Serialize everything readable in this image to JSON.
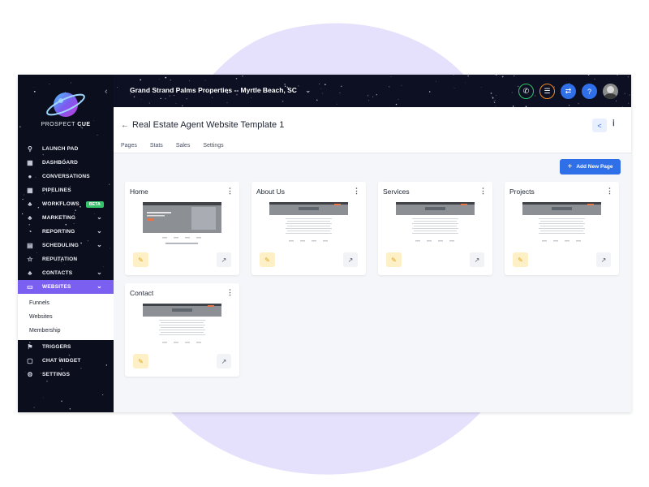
{
  "sidebar": {
    "brand_main": "PROSPECT",
    "brand_accent": "CUE",
    "collapse_icon": "‹",
    "nav": [
      {
        "label": "LAUNCH PAD",
        "icon": "rocket-icon",
        "glyph": "⚲"
      },
      {
        "label": "DASHBOARD",
        "icon": "dashboard-icon",
        "glyph": "▦"
      },
      {
        "label": "CONVERSATIONS",
        "icon": "conversations-icon",
        "glyph": "●"
      },
      {
        "label": "PIPELINES",
        "icon": "pipelines-icon",
        "glyph": "▦"
      },
      {
        "label": "WORKFLOWS",
        "icon": "workflows-icon",
        "glyph": "♣",
        "badge": "BETA"
      },
      {
        "label": "MARKETING",
        "icon": "marketing-icon",
        "glyph": "♣",
        "chevron": "⌄"
      },
      {
        "label": "REPORTING",
        "icon": "reporting-icon",
        "glyph": "◔",
        "chevron": "⌄"
      },
      {
        "label": "SCHEDULING",
        "icon": "calendar-icon",
        "glyph": "▤",
        "chevron": "⌄"
      },
      {
        "label": "REPUTATION",
        "icon": "star-icon",
        "glyph": "☆"
      },
      {
        "label": "CONTACTS",
        "icon": "contacts-icon",
        "glyph": "♣",
        "chevron": "⌄"
      },
      {
        "label": "WEBSITES",
        "icon": "monitor-icon",
        "glyph": "▭",
        "chevron": "⌄",
        "active": true
      }
    ],
    "submenu": [
      "Funnels",
      "Websites",
      "Membership"
    ],
    "nav_bottom": [
      {
        "label": "TRIGGERS",
        "icon": "triggers-icon",
        "glyph": "⚑"
      },
      {
        "label": "CHAT WIDGET",
        "icon": "chat-icon",
        "glyph": "▢"
      },
      {
        "label": "SETTINGS",
        "icon": "gear-icon",
        "glyph": "⚙"
      }
    ]
  },
  "topbar": {
    "location": "Grand Strand Palms Properties -- Myrtle Beach, SC",
    "dropdown_icon": "⌄",
    "buttons": [
      {
        "icon": "phone-icon",
        "glyph": "✆",
        "ring": "#35c36b",
        "fill": "#0d1022"
      },
      {
        "icon": "notes-icon",
        "glyph": "☰",
        "ring": "#f08a24",
        "fill": "#0d1022"
      },
      {
        "icon": "switch-icon",
        "glyph": "⇄",
        "ring": "#2f6fe8",
        "fill": "#2f6fe8"
      },
      {
        "icon": "help-icon",
        "glyph": "?",
        "ring": "#2f6fe8",
        "fill": "#2f6fe8"
      }
    ]
  },
  "page": {
    "back_icon": "←",
    "title": "Real Estate Agent Website Template 1",
    "share_icon": "<",
    "info_icon": "ⅰ",
    "tabs": [
      "Pages",
      "Stats",
      "Sales",
      "Settings"
    ],
    "add_button": "Add New Page",
    "add_icon": "+"
  },
  "cards": [
    {
      "name": "Home",
      "variant": "home"
    },
    {
      "name": "About Us",
      "variant": "inner"
    },
    {
      "name": "Services",
      "variant": "inner"
    },
    {
      "name": "Projects",
      "variant": "inner"
    },
    {
      "name": "Contact",
      "variant": "inner"
    }
  ],
  "card_actions": {
    "kebab": "⋮",
    "edit_glyph": "✎",
    "open_glyph": "↗"
  },
  "colors": {
    "accent_purple": "#7b5ff0",
    "primary_blue": "#2f6fe8",
    "beta_green": "#35c36b",
    "blob": "#e5e0fb"
  }
}
